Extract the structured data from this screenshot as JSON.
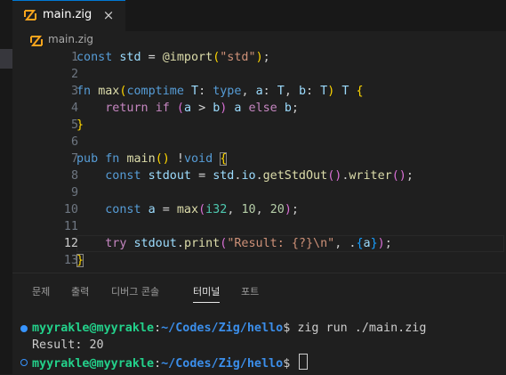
{
  "tab": {
    "filename": "main.zig",
    "close_glyph": "×"
  },
  "breadcrumb": {
    "file": "main.zig"
  },
  "editor": {
    "current_line": 12,
    "lines": [
      {
        "n": "1",
        "code": "const std = @import(\"std\");"
      },
      {
        "n": "2",
        "code": ""
      },
      {
        "n": "3",
        "code": "fn max(comptime T: type, a: T, b: T) T {"
      },
      {
        "n": "4",
        "code": "    return if (a > b) a else b;"
      },
      {
        "n": "5",
        "code": "}"
      },
      {
        "n": "6",
        "code": ""
      },
      {
        "n": "7",
        "code": "pub fn main() !void {"
      },
      {
        "n": "8",
        "code": "    const stdout = std.io.getStdOut().writer();"
      },
      {
        "n": "9",
        "code": ""
      },
      {
        "n": "10",
        "code": "    const a = max(i32, 10, 20);"
      },
      {
        "n": "11",
        "code": ""
      },
      {
        "n": "12",
        "code": "    try stdout.print(\"Result: {?}\\n\", .{a});"
      },
      {
        "n": "13",
        "code": "}"
      }
    ]
  },
  "panel": {
    "tabs": [
      "문제",
      "출력",
      "디버그 콘솔",
      "터미널",
      "포트"
    ],
    "active_tab": "터미널"
  },
  "terminal": {
    "user": "myyrakle@myyrakle",
    "path": "~/Codes/Zig/hello",
    "prompt_symbol": "$",
    "command": "zig run ./main.zig",
    "output": "Result: 20"
  },
  "colors": {
    "accent": "#0078d4",
    "terminal_user": "#23d18b",
    "terminal_path": "#3b8eea",
    "editor_bg": "#1f1f1f"
  }
}
